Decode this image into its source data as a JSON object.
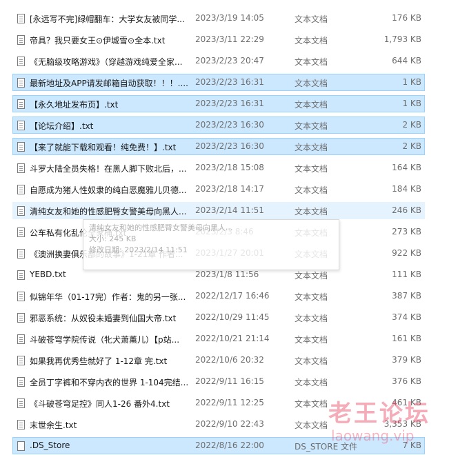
{
  "files": [
    {
      "name": "[永远写不完]绿帽翻车：大学女友被同学...",
      "date": "2023/3/19 14:05",
      "type": "文本文档",
      "size": "176 KB",
      "state": "normal",
      "icon": "text-file-icon"
    },
    {
      "name": "帝具？我只要女王⊙伊城雪⊙全本.txt",
      "date": "2023/3/11 22:29",
      "type": "文本文档",
      "size": "1,793 KB",
      "state": "normal",
      "icon": "text-file-icon"
    },
    {
      "name": "《无脑级攻略游戏》（穿越游戏纯爱全家...",
      "date": "2023/2/23 20:47",
      "type": "文本文档",
      "size": "644 KB",
      "state": "normal",
      "icon": "text-file-icon"
    },
    {
      "name": "最新地址及APP请发邮箱自动获取！！！....",
      "date": "2023/2/23 16:31",
      "type": "文本文档",
      "size": "1 KB",
      "state": "selected",
      "icon": "text-file-icon"
    },
    {
      "name": "【永久地址发布页】.txt",
      "date": "2023/2/23 16:31",
      "type": "文本文档",
      "size": "1 KB",
      "state": "selected",
      "icon": "text-file-icon"
    },
    {
      "name": "【论坛介绍】.txt",
      "date": "2023/2/23 16:30",
      "type": "文本文档",
      "size": "2 KB",
      "state": "selected",
      "icon": "text-file-icon"
    },
    {
      "name": "【来了就能下载和观看！纯免费！】.txt",
      "date": "2023/2/23 16:30",
      "type": "文本文档",
      "size": "2 KB",
      "state": "selected",
      "icon": "text-file-icon"
    },
    {
      "name": "斗罗大陆全员失格！在黑人脚下败北后，...",
      "date": "2023/2/18 15:08",
      "type": "文本文档",
      "size": "164 KB",
      "state": "normal",
      "icon": "text-file-icon"
    },
    {
      "name": "自愿成为猪人性奴隶的纯白恶魔雅儿贝德...",
      "date": "2023/2/18 14:17",
      "type": "文本文档",
      "size": "184 KB",
      "state": "normal",
      "icon": "text-file-icon"
    },
    {
      "name": "清纯女友和她的性感肥臀女警美母向黑人...",
      "date": "2023/2/14 11:51",
      "type": "文本文档",
      "size": "246 KB",
      "state": "hover",
      "icon": "text-file-icon"
    },
    {
      "name": "公车私有化乱伦全家桶.txt",
      "date": "2023/2/3 8:46",
      "type": "文本文档",
      "size": "273 KB",
      "state": "normal",
      "icon": "text-file-icon"
    },
    {
      "name": "《澳洲换妻俱乐部的故事》1-21章 作者...",
      "date": "2023/1/27 20:01",
      "type": "文本文档",
      "size": "922 KB",
      "state": "normal",
      "icon": "text-file-icon"
    },
    {
      "name": "YEBD.txt",
      "date": "2023/1/8 11:56",
      "type": "文本文档",
      "size": "111 KB",
      "state": "normal",
      "icon": "text-file-icon"
    },
    {
      "name": "似锦年华（01-17完）作者：鬼的另一张...",
      "date": "2022/12/17 16:46",
      "type": "文本文档",
      "size": "387 KB",
      "state": "normal",
      "icon": "text-file-icon"
    },
    {
      "name": "邪恶系统：从奴役未婚妻到仙国大帝.txt",
      "date": "2022/10/29 11:45",
      "type": "文本文档",
      "size": "374 KB",
      "state": "normal",
      "icon": "text-file-icon"
    },
    {
      "name": "斗破苍穹学院传说（牝犬萧薰儿）【p站...",
      "date": "2022/10/21 21:14",
      "type": "文本文档",
      "size": "161 KB",
      "state": "normal",
      "icon": "text-file-icon"
    },
    {
      "name": "如果我再优秀些就好了 1-12章 完.txt",
      "date": "2022/10/6 20:32",
      "type": "文本文档",
      "size": "379 KB",
      "state": "normal",
      "icon": "text-file-icon"
    },
    {
      "name": "全员丁字裤和不穿内衣的世界 1-104完结...",
      "date": "2022/9/11 16:15",
      "type": "文本文档",
      "size": "376 KB",
      "state": "normal",
      "icon": "text-file-icon"
    },
    {
      "name": "《斗破苍穹足控》同人1-26 番外4.txt",
      "date": "2022/9/11 12:25",
      "type": "文本文档",
      "size": "461 KB",
      "state": "normal",
      "icon": "text-file-icon"
    },
    {
      "name": "末世余生.txt",
      "date": "2022/9/10 22:43",
      "type": "文本文档",
      "size": "3,353 KB",
      "state": "normal",
      "icon": "text-file-icon"
    },
    {
      "name": ".DS_Store",
      "date": "2022/8/16 22:00",
      "type": "DS_STORE 文件",
      "size": "7 KB",
      "state": "selected",
      "icon": "blank-file-icon"
    }
  ],
  "tooltip": {
    "line1": "清纯女友和她的性感肥臀女警美母向黑人...",
    "line2": "大小: 245 KB",
    "line3": "修改日期: 2023/2/14 11:51"
  },
  "watermark": {
    "cn": "老王论坛",
    "en": "laowang.vip"
  }
}
